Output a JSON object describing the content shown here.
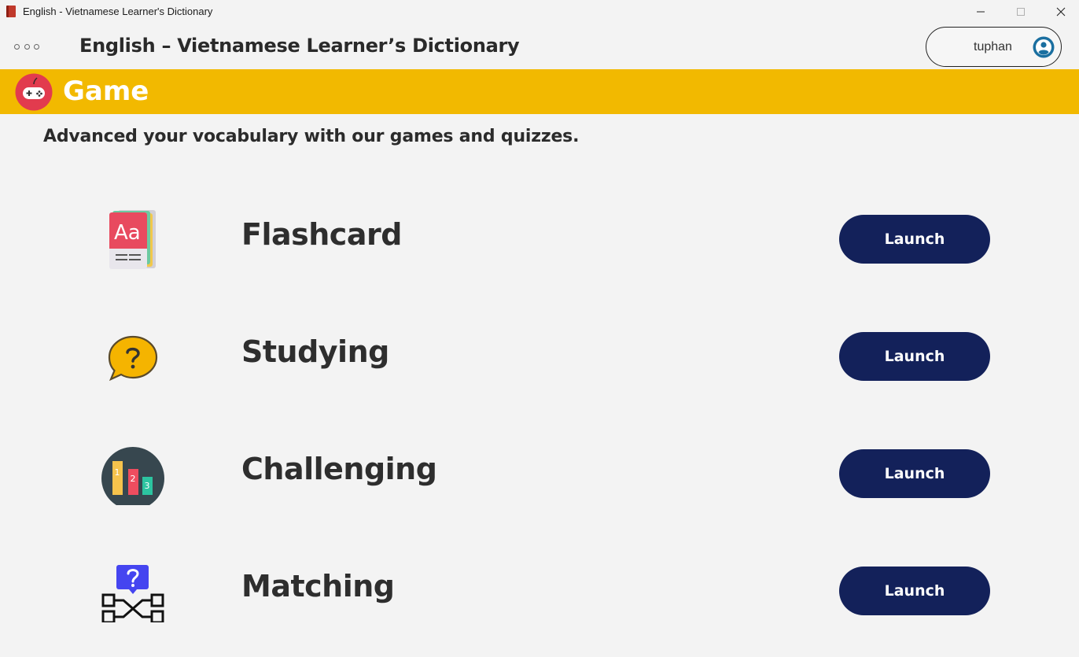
{
  "window": {
    "title": "English - Vietnamese Learner's Dictionary",
    "controls": [
      "minimize-icon",
      "maximize-icon",
      "close-icon"
    ]
  },
  "header": {
    "menu_icon": "more-dots-icon",
    "title": "English – Vietnamese Learner’s Dictionary",
    "user": {
      "name": "tuphan",
      "icon": "user-avatar-icon"
    }
  },
  "banner": {
    "icon": "gamepad-icon",
    "title": "Game",
    "color": "#f2b900"
  },
  "subtitle": "Advanced your vocabulary with our games and quizzes.",
  "games": [
    {
      "name": "Flashcard",
      "icon": "flashcard-icon",
      "button": "Launch"
    },
    {
      "name": "Studying",
      "icon": "question-bubble-icon",
      "button": "Launch"
    },
    {
      "name": "Challenging",
      "icon": "leaderboard-icon",
      "button": "Launch"
    },
    {
      "name": "Matching",
      "icon": "matching-icon",
      "button": "Launch"
    }
  ],
  "colors": {
    "accent": "#13215a",
    "background": "#f3f3f3"
  }
}
